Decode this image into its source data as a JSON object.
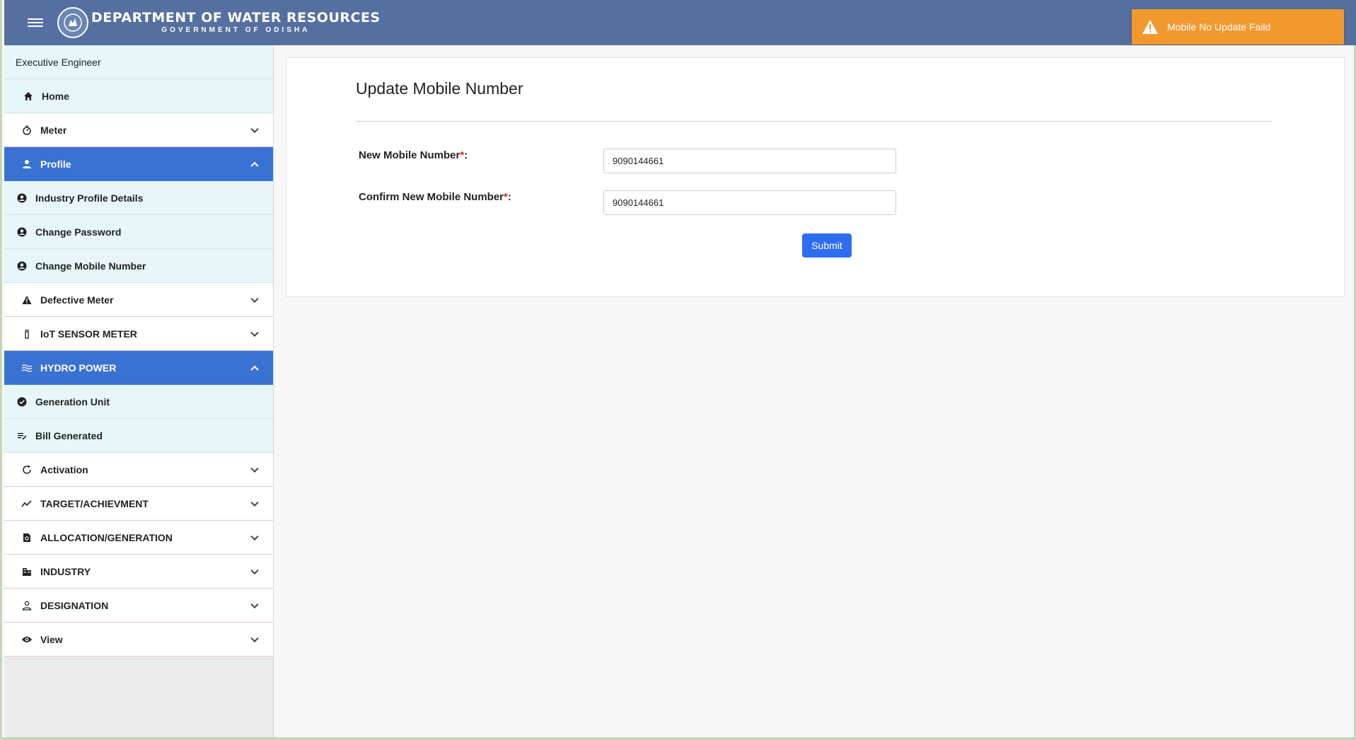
{
  "header": {
    "title": "DEPARTMENT OF WATER RESOURCES",
    "subtitle": "GOVERNMENT OF ODISHA"
  },
  "toast": {
    "message": "Mobile No Update Faild",
    "color": "#f2992e",
    "icon": "warning-icon"
  },
  "sidebar": {
    "role": "Executive Engineer",
    "home": "Home",
    "meter": "Meter",
    "profile": "Profile",
    "profile_items": [
      "Industry Profile Details",
      "Change Password",
      "Change Mobile Number"
    ],
    "defective_meter": "Defective Meter",
    "iot_sensor_meter": "IoT SENSOR METER",
    "hydro_power": "HYDRO POWER",
    "hydro_items": [
      "Generation Unit",
      "Bill Generated"
    ],
    "activation": "Activation",
    "target": "TARGET/ACHIEVMENT",
    "allocation": "ALLOCATION/GENERATION",
    "industry": "INDUSTRY",
    "designation": "DESIGNATION",
    "view": "View"
  },
  "form": {
    "title": "Update Mobile Number",
    "new_label": "New Mobile Number",
    "confirm_label": "Confirm New Mobile Number",
    "required_mark": "*",
    "colon": ":",
    "new_value": "9090144661",
    "confirm_value": "9090144661",
    "submit_label": "Submit"
  },
  "colors": {
    "header": "#5570a0",
    "active_nav": "#3a72d4",
    "submit": "#2f6df0"
  }
}
